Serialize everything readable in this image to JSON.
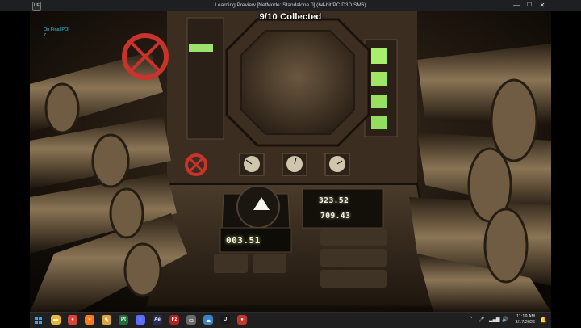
{
  "window": {
    "icon_label": "UE",
    "title": "Learning Preview [NetMode: Standalone 0]  (64-bit/PC D3D SM6)",
    "minimize": "—",
    "maximize": "☐",
    "close": "✕"
  },
  "hud": {
    "collected": "9/10 Collected",
    "poi_label": "On Final POI",
    "poi_value": "7"
  },
  "console": {
    "readout_top": "323.52",
    "readout_bottom": "709.43",
    "readout_left": "003.51"
  },
  "taskbar": {
    "apps": [
      {
        "name": "file-explorer",
        "glyph": "▬",
        "color": "#e8b63a"
      },
      {
        "name": "chrome",
        "glyph": "●",
        "color": "#db4437"
      },
      {
        "name": "firefox",
        "glyph": "●",
        "color": "#ff7a1a"
      },
      {
        "name": "paint",
        "glyph": "✎",
        "color": "#d9a441"
      },
      {
        "name": "pt",
        "glyph": "Pt",
        "color": "#1f6f3a"
      },
      {
        "name": "settings",
        "glyph": "◌",
        "color": "#5b6cff"
      },
      {
        "name": "after-effects",
        "glyph": "Ae",
        "color": "#2b2a5c"
      },
      {
        "name": "filezilla",
        "glyph": "Fz",
        "color": "#b22222"
      },
      {
        "name": "folder",
        "glyph": "▭",
        "color": "#6b6b6b"
      },
      {
        "name": "cloud",
        "glyph": "☁",
        "color": "#3b82c4"
      },
      {
        "name": "unreal",
        "glyph": "U",
        "color": "#1a1a1a"
      },
      {
        "name": "recorder",
        "glyph": "●",
        "color": "#c0392b"
      }
    ],
    "tray_arrow": "^",
    "time": "11:19 AM",
    "date": "3/17/2026",
    "bell": "🔔"
  }
}
